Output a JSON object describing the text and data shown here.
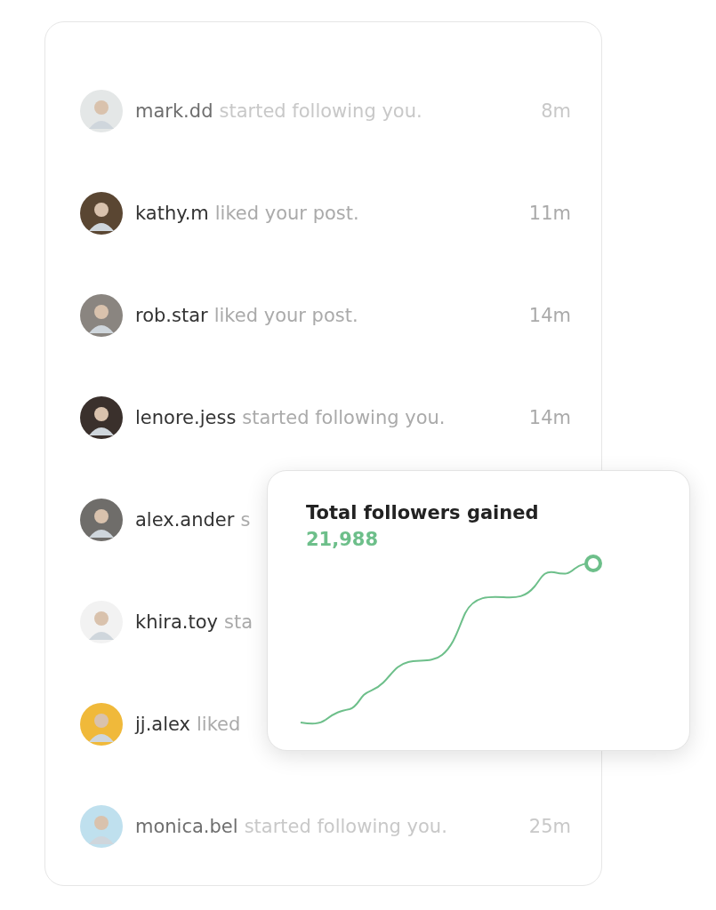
{
  "notifications": [
    {
      "user": "mark.dd",
      "action": "started following you.",
      "time": "8m",
      "faded": true,
      "color": "#e4e7e7"
    },
    {
      "user": "kathy.m",
      "action": "liked your post.",
      "time": "11m",
      "faded": false,
      "color": "#5a4632"
    },
    {
      "user": "rob.star",
      "action": "liked your post.",
      "time": "14m",
      "faded": false,
      "color": "#8a8580"
    },
    {
      "user": "lenore.jess",
      "action": "started following you.",
      "time": "14m",
      "faded": false,
      "color": "#3a302c"
    },
    {
      "user": "alex.ander",
      "action": "s",
      "faded": false,
      "color": "#6f6d6a"
    },
    {
      "user": "khira.toy",
      "action": "sta",
      "faded": false,
      "color": "#f2f2f2"
    },
    {
      "user": "jj.alex",
      "action": "liked",
      "faded": false,
      "color": "#f0b93a"
    },
    {
      "user": "monica.bel",
      "action": "started following you.",
      "time": "25m",
      "faded": true,
      "color": "#bfe0ee"
    }
  ],
  "stats_card": {
    "title": "Total followers gained",
    "value": "21,988"
  }
}
